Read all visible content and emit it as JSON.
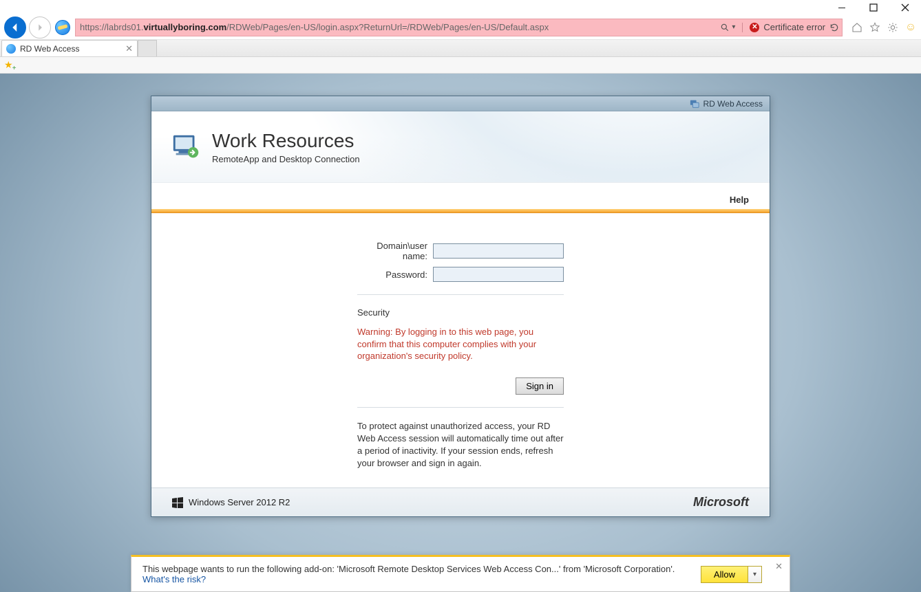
{
  "window": {
    "minimize": "–",
    "maximize": "□",
    "close": "✕"
  },
  "browser": {
    "url_prefix": "https://labrds01.",
    "url_bold": "virtuallyboring.com",
    "url_suffix": "/RDWeb/Pages/en-US/login.aspx?ReturnUrl=/RDWeb/Pages/en-US/Default.aspx",
    "cert_error": "Certificate error",
    "tab_title": "RD Web Access"
  },
  "page": {
    "head_label": "RD Web Access",
    "title": "Work Resources",
    "subtitle": "RemoteApp and Desktop Connection",
    "help": "Help",
    "labels": {
      "username": "Domain\\user name:",
      "password": "Password:"
    },
    "fields": {
      "username_value": "",
      "password_value": ""
    },
    "security_title": "Security",
    "security_warning": "Warning: By logging in to this web page, you confirm that this computer complies with your organization's security policy.",
    "signin": "Sign in",
    "timeout_info": "To protect against unauthorized access, your RD Web Access session will automatically time out after a period of inactivity. If your session ends, refresh your browser and sign in again.",
    "footer_product": "Windows Server 2012 R2",
    "footer_brand": "Microsoft"
  },
  "notification": {
    "message": "This webpage wants to run the following add-on: 'Microsoft Remote Desktop Services Web Access Con...' from 'Microsoft Corporation'.",
    "risk_link": "What's the risk?",
    "allow": "Allow"
  }
}
